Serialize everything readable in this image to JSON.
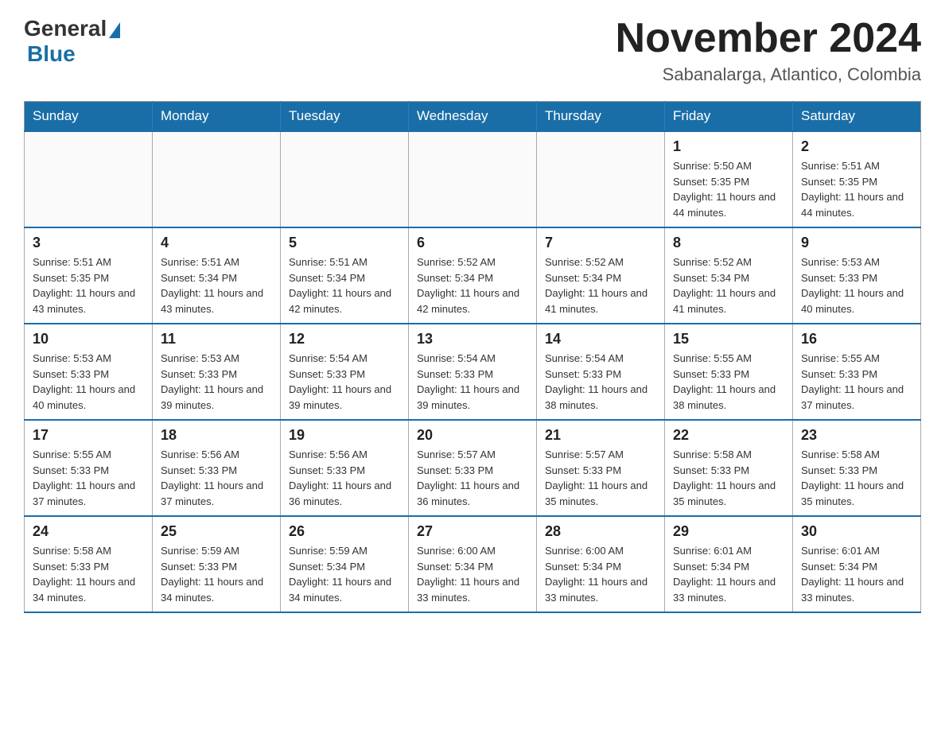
{
  "header": {
    "logo_general": "General",
    "logo_blue": "Blue",
    "month_title": "November 2024",
    "location": "Sabanalarga, Atlantico, Colombia"
  },
  "weekdays": [
    "Sunday",
    "Monday",
    "Tuesday",
    "Wednesday",
    "Thursday",
    "Friday",
    "Saturday"
  ],
  "weeks": [
    [
      {
        "day": "",
        "info": ""
      },
      {
        "day": "",
        "info": ""
      },
      {
        "day": "",
        "info": ""
      },
      {
        "day": "",
        "info": ""
      },
      {
        "day": "",
        "info": ""
      },
      {
        "day": "1",
        "info": "Sunrise: 5:50 AM\nSunset: 5:35 PM\nDaylight: 11 hours and 44 minutes."
      },
      {
        "day": "2",
        "info": "Sunrise: 5:51 AM\nSunset: 5:35 PM\nDaylight: 11 hours and 44 minutes."
      }
    ],
    [
      {
        "day": "3",
        "info": "Sunrise: 5:51 AM\nSunset: 5:35 PM\nDaylight: 11 hours and 43 minutes."
      },
      {
        "day": "4",
        "info": "Sunrise: 5:51 AM\nSunset: 5:34 PM\nDaylight: 11 hours and 43 minutes."
      },
      {
        "day": "5",
        "info": "Sunrise: 5:51 AM\nSunset: 5:34 PM\nDaylight: 11 hours and 42 minutes."
      },
      {
        "day": "6",
        "info": "Sunrise: 5:52 AM\nSunset: 5:34 PM\nDaylight: 11 hours and 42 minutes."
      },
      {
        "day": "7",
        "info": "Sunrise: 5:52 AM\nSunset: 5:34 PM\nDaylight: 11 hours and 41 minutes."
      },
      {
        "day": "8",
        "info": "Sunrise: 5:52 AM\nSunset: 5:34 PM\nDaylight: 11 hours and 41 minutes."
      },
      {
        "day": "9",
        "info": "Sunrise: 5:53 AM\nSunset: 5:33 PM\nDaylight: 11 hours and 40 minutes."
      }
    ],
    [
      {
        "day": "10",
        "info": "Sunrise: 5:53 AM\nSunset: 5:33 PM\nDaylight: 11 hours and 40 minutes."
      },
      {
        "day": "11",
        "info": "Sunrise: 5:53 AM\nSunset: 5:33 PM\nDaylight: 11 hours and 39 minutes."
      },
      {
        "day": "12",
        "info": "Sunrise: 5:54 AM\nSunset: 5:33 PM\nDaylight: 11 hours and 39 minutes."
      },
      {
        "day": "13",
        "info": "Sunrise: 5:54 AM\nSunset: 5:33 PM\nDaylight: 11 hours and 39 minutes."
      },
      {
        "day": "14",
        "info": "Sunrise: 5:54 AM\nSunset: 5:33 PM\nDaylight: 11 hours and 38 minutes."
      },
      {
        "day": "15",
        "info": "Sunrise: 5:55 AM\nSunset: 5:33 PM\nDaylight: 11 hours and 38 minutes."
      },
      {
        "day": "16",
        "info": "Sunrise: 5:55 AM\nSunset: 5:33 PM\nDaylight: 11 hours and 37 minutes."
      }
    ],
    [
      {
        "day": "17",
        "info": "Sunrise: 5:55 AM\nSunset: 5:33 PM\nDaylight: 11 hours and 37 minutes."
      },
      {
        "day": "18",
        "info": "Sunrise: 5:56 AM\nSunset: 5:33 PM\nDaylight: 11 hours and 37 minutes."
      },
      {
        "day": "19",
        "info": "Sunrise: 5:56 AM\nSunset: 5:33 PM\nDaylight: 11 hours and 36 minutes."
      },
      {
        "day": "20",
        "info": "Sunrise: 5:57 AM\nSunset: 5:33 PM\nDaylight: 11 hours and 36 minutes."
      },
      {
        "day": "21",
        "info": "Sunrise: 5:57 AM\nSunset: 5:33 PM\nDaylight: 11 hours and 35 minutes."
      },
      {
        "day": "22",
        "info": "Sunrise: 5:58 AM\nSunset: 5:33 PM\nDaylight: 11 hours and 35 minutes."
      },
      {
        "day": "23",
        "info": "Sunrise: 5:58 AM\nSunset: 5:33 PM\nDaylight: 11 hours and 35 minutes."
      }
    ],
    [
      {
        "day": "24",
        "info": "Sunrise: 5:58 AM\nSunset: 5:33 PM\nDaylight: 11 hours and 34 minutes."
      },
      {
        "day": "25",
        "info": "Sunrise: 5:59 AM\nSunset: 5:33 PM\nDaylight: 11 hours and 34 minutes."
      },
      {
        "day": "26",
        "info": "Sunrise: 5:59 AM\nSunset: 5:34 PM\nDaylight: 11 hours and 34 minutes."
      },
      {
        "day": "27",
        "info": "Sunrise: 6:00 AM\nSunset: 5:34 PM\nDaylight: 11 hours and 33 minutes."
      },
      {
        "day": "28",
        "info": "Sunrise: 6:00 AM\nSunset: 5:34 PM\nDaylight: 11 hours and 33 minutes."
      },
      {
        "day": "29",
        "info": "Sunrise: 6:01 AM\nSunset: 5:34 PM\nDaylight: 11 hours and 33 minutes."
      },
      {
        "day": "30",
        "info": "Sunrise: 6:01 AM\nSunset: 5:34 PM\nDaylight: 11 hours and 33 minutes."
      }
    ]
  ]
}
